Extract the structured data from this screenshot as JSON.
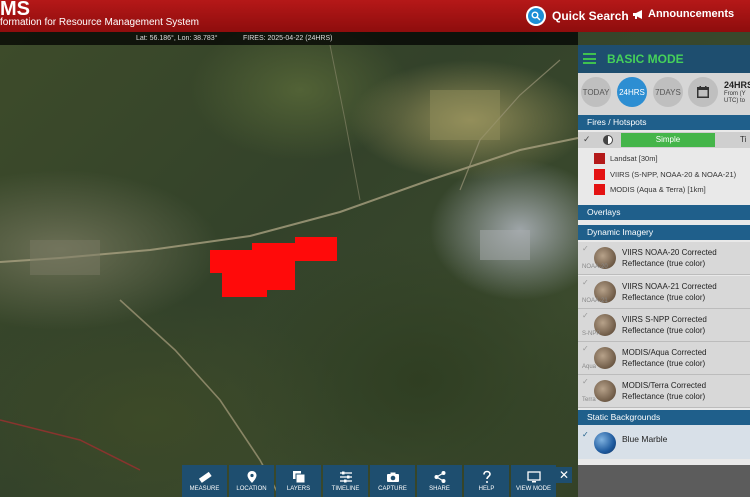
{
  "header": {
    "app_title": "MS",
    "app_subtitle": "formation for Resource Management System",
    "quick_search_label": "Quick Search",
    "announcements_label": "Announcements"
  },
  "info_bar": {
    "coords": "Lat: 56.186°, Lon: 38.783°",
    "fires_label": "FIRES: 2025-04-22 (24HRS)"
  },
  "panel": {
    "mode_title": "BASIC MODE",
    "time_buttons": [
      {
        "label": "TODAY",
        "active": false
      },
      {
        "label": "24HRS",
        "active": true
      },
      {
        "label": "7DAYS",
        "active": false
      }
    ],
    "range_title": "24HRS",
    "range_from": "From (Y",
    "range_utc": "UTC) to",
    "sections": {
      "fires": "Fires / Hotspots",
      "overlays": "Overlays",
      "dynamic_imagery": "Dynamic Imagery",
      "static_backgrounds": "Static Backgrounds"
    },
    "fire_tabs": {
      "check": "✓",
      "simple": "Simple",
      "timeline": "Ti"
    },
    "fire_legend": [
      {
        "label": "Landsat [30m]",
        "color": "#b41a1a"
      },
      {
        "label": "VIIRS (S-NPP, NOAA-20 & NOAA-21)",
        "color": "#e41212"
      },
      {
        "label": "MODIS (Aqua & Terra) [1km]",
        "color": "#e41212"
      }
    ],
    "imagery": [
      {
        "name": "VIIRS NOAA-20 Corrected",
        "sub": "Reflectance (true color)",
        "tag": "NOAA-20"
      },
      {
        "name": "VIIRS NOAA-21 Corrected",
        "sub": "Reflectance (true color)",
        "tag": "NOAA-21"
      },
      {
        "name": "VIIRS S-NPP Corrected",
        "sub": "Reflectance (true color)",
        "tag": "S-NPP"
      },
      {
        "name": "MODIS/Aqua Corrected",
        "sub": "Reflectance (true color)",
        "tag": "Aqua"
      },
      {
        "name": "MODIS/Terra Corrected",
        "sub": "Reflectance (true color)",
        "tag": "Terra"
      }
    ],
    "background": {
      "name": "Blue Marble",
      "check": "✓"
    }
  },
  "toolbar": {
    "tools": [
      {
        "label": "MEASURE",
        "icon": "ruler-icon"
      },
      {
        "label": "LOCATION",
        "icon": "location-pin-icon"
      },
      {
        "label": "LAYERS",
        "icon": "layers-icon"
      },
      {
        "label": "TIMELINE",
        "icon": "sliders-icon"
      },
      {
        "label": "CAPTURE",
        "icon": "camera-icon"
      },
      {
        "label": "SHARE",
        "icon": "share-icon"
      },
      {
        "label": "HELP",
        "icon": "help-icon"
      },
      {
        "label": "VIEW MODE",
        "icon": "monitor-icon"
      }
    ],
    "close_label": "✕"
  },
  "colors": {
    "header_red": "#a81313",
    "panel_blue": "#1f5f8b",
    "mode_green": "#45d15a",
    "active_blue": "#2d8ed2",
    "fire_red": "#ff0a0a"
  }
}
